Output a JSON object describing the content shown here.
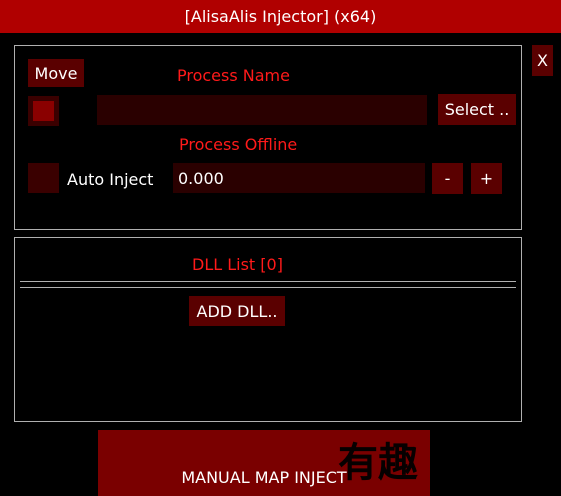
{
  "window": {
    "title": "[AlisaAlis Injector] (x64)",
    "close_label": "X"
  },
  "process": {
    "move_label": "Move",
    "name_heading": "Process Name",
    "name_value": "",
    "select_label": "Select ..",
    "offline_heading": "Process Offline",
    "auto_inject_label": "Auto Inject",
    "delay_value": "0.000",
    "minus_label": "-",
    "plus_label": "+"
  },
  "dll": {
    "heading": "DLL List [0]",
    "add_label": "ADD DLL.."
  },
  "inject": {
    "label": "MANUAL MAP INJECT"
  },
  "watermark": {
    "text": "有趣"
  },
  "colors": {
    "titlebar": "#b00000",
    "accent_text": "#ff1a1a",
    "button": "#5a0000",
    "field": "#2a0000",
    "inject_button": "#7a0000"
  }
}
